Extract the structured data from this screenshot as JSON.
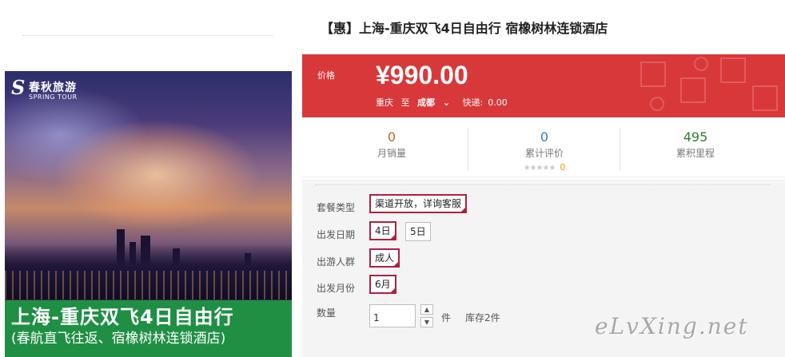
{
  "hero": {
    "logo_cn": "春秋旅游",
    "logo_en": "SPRING TOUR",
    "banner_title": "上海-重庆双飞4日自由行",
    "banner_subtitle": "(春航直飞往返、宿橡树林连锁酒店)"
  },
  "product": {
    "title": "【惠】上海-重庆双飞4日自由行 宿橡树林连锁酒店"
  },
  "price": {
    "label": "价格",
    "value": "¥990.00",
    "origin": "重庆",
    "to": "至",
    "destination": "成都",
    "dest_chevron": "⌄",
    "express_label": "快递:",
    "express_value": "0.00"
  },
  "stats": {
    "monthly_sales": {
      "value": "0",
      "label": "月销量",
      "color": "#b26b2a"
    },
    "reviews": {
      "value": "0",
      "label": "累计评价",
      "stars": "★★★★★",
      "star_count": "0",
      "color": "#2b7fc2"
    },
    "points": {
      "value": "495",
      "label": "累积里程",
      "color": "#2e7d32"
    }
  },
  "options": {
    "package": {
      "label": "套餐类型",
      "choices": [
        "渠道开放，详询客服"
      ]
    },
    "departure_date": {
      "label": "出发日期",
      "choices": [
        "4日",
        "5日"
      ]
    },
    "travelers": {
      "label": "出游人群",
      "choices": [
        "成人"
      ]
    },
    "month": {
      "label": "出发月份",
      "choices": [
        "6月"
      ]
    },
    "quantity": {
      "label": "数量",
      "value": "1",
      "unit": "件",
      "stock": "库存2件"
    }
  },
  "watermark": "eLvXing.net",
  "colors": {
    "price_bg": "#d9383a",
    "banner_green": "#1f8f44",
    "chip_border": "#b0203e"
  },
  "icons": {
    "up": "▲",
    "down": "▼",
    "tick": "✓"
  }
}
